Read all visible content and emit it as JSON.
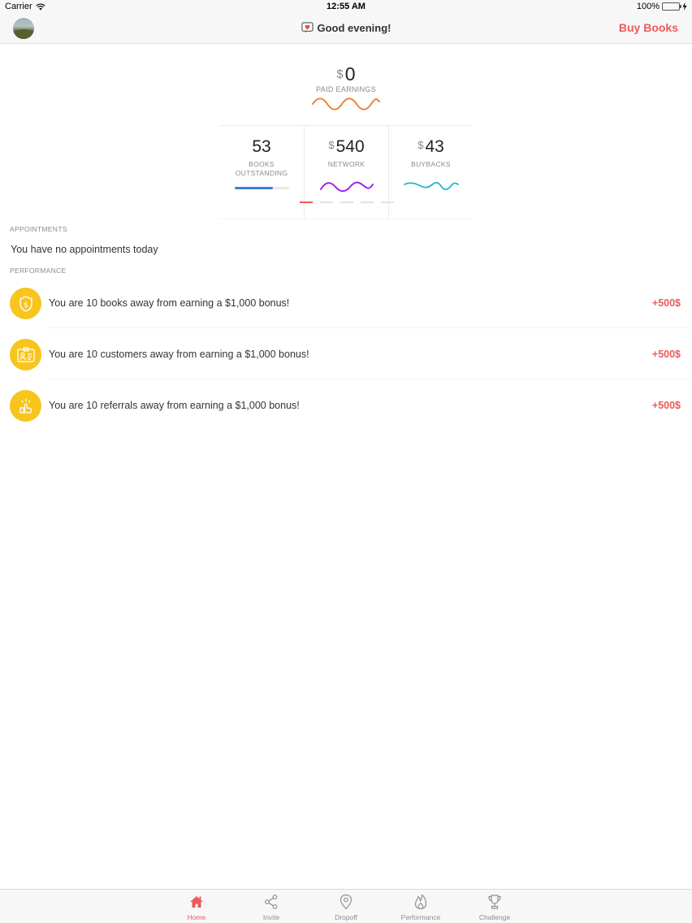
{
  "status_bar": {
    "carrier": "Carrier",
    "time": "12:55 AM",
    "battery": "100%"
  },
  "nav": {
    "greeting": "Good evening!",
    "buy_books": "Buy Books",
    "avatar_icon": "user-avatar-photo",
    "greeting_icon": "chat-heart-icon"
  },
  "earnings": {
    "paid": {
      "currency": "$",
      "value": "0",
      "label": "PAID EARNINGS",
      "color": "#f07f3c"
    },
    "stats": [
      {
        "currency": "",
        "value": "53",
        "label": "BOOKS OUTSTANDING",
        "progress": 0.7,
        "color": "#3d7fd9"
      },
      {
        "currency": "$",
        "value": "540",
        "label": "NETWORK",
        "color": "#a020f0"
      },
      {
        "currency": "$",
        "value": "43",
        "label": "BUYBACKS",
        "color": "#1fb3c9"
      }
    ],
    "pager": {
      "pages": 5,
      "active": 0
    }
  },
  "appointments": {
    "header": "APPOINTMENTS",
    "empty_text": "You have no appointments today"
  },
  "performance": {
    "header": "PERFORMANCE",
    "badge_color": "#f7c51e",
    "accent": "#ec5a5a",
    "items": [
      {
        "icon": "shield-dollar-icon",
        "text": "You are 10 books away from earning a $1,000 bonus!",
        "bonus": "+500$"
      },
      {
        "icon": "id-card-icon",
        "text": "You are 10 customers away from earning a $1,000 bonus!",
        "bonus": "+500$"
      },
      {
        "icon": "hand-tap-icon",
        "text": "You are 10 referrals away from earning a $1,000 bonus!",
        "bonus": "+500$"
      }
    ]
  },
  "tabs": [
    {
      "label": "Home",
      "icon": "home-icon",
      "active": true
    },
    {
      "label": "Invite",
      "icon": "share-icon",
      "active": false
    },
    {
      "label": "Dropoff",
      "icon": "map-pin-icon",
      "active": false
    },
    {
      "label": "Performance",
      "icon": "flame-icon",
      "active": false
    },
    {
      "label": "Challenge",
      "icon": "trophy-icon",
      "active": false
    }
  ]
}
